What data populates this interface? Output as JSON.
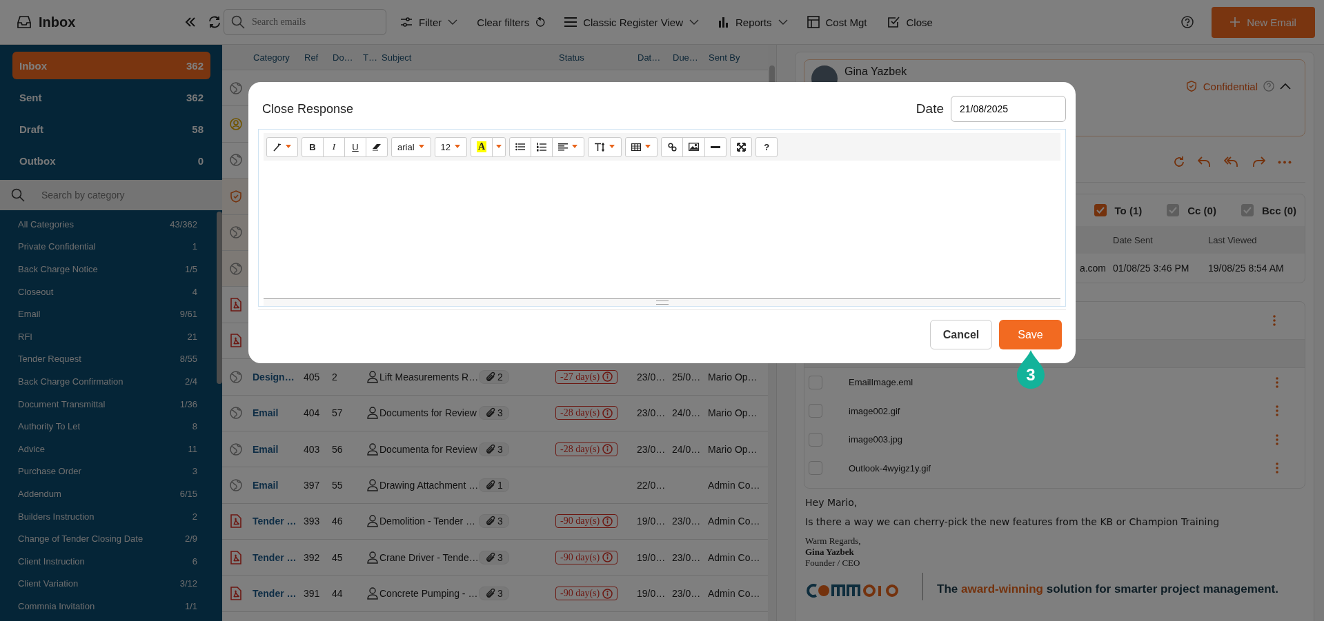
{
  "app_header": {
    "title": "Inbox"
  },
  "toolbar": {
    "search": {
      "placeholder": "Search emails"
    },
    "items": [
      {
        "kind": "filter",
        "label": "Filter",
        "caret": true
      },
      {
        "kind": "clear",
        "label": "Clear filters",
        "caret": false
      },
      {
        "kind": "view",
        "label": "Classic Register View",
        "caret": true
      },
      {
        "kind": "reports",
        "label": "Reports",
        "caret": true
      },
      {
        "kind": "cost",
        "label": "Cost Mgt",
        "caret": false
      },
      {
        "kind": "close",
        "label": "Close",
        "caret": false
      }
    ],
    "new_button": "New Email"
  },
  "folders": [
    {
      "label": "Inbox",
      "count": "362",
      "selected": true
    },
    {
      "label": "Sent",
      "count": "362",
      "selected": false
    },
    {
      "label": "Draft",
      "count": "58",
      "selected": false
    },
    {
      "label": "Outbox",
      "count": "0",
      "selected": false
    }
  ],
  "category_search": {
    "placeholder": "Search by category"
  },
  "categories": [
    {
      "label": "All Categories",
      "count": "43/362"
    },
    {
      "label": "Private Confidential",
      "count": "1"
    },
    {
      "label": "Back Charge Notice",
      "count": "1/5"
    },
    {
      "label": "Closeout",
      "count": "4"
    },
    {
      "label": "Email",
      "count": "9/61"
    },
    {
      "label": "RFI",
      "count": "21"
    },
    {
      "label": "Tender Request",
      "count": "8/55"
    },
    {
      "label": "Back Charge Confirmation",
      "count": "2/4"
    },
    {
      "label": "Document Transmittal",
      "count": "1/36"
    },
    {
      "label": "Authority To Let",
      "count": "8"
    },
    {
      "label": "Advice",
      "count": "11"
    },
    {
      "label": "Purchase Order",
      "count": "3"
    },
    {
      "label": "Addendum",
      "count": "6/15"
    },
    {
      "label": "Builders Instruction",
      "count": "2"
    },
    {
      "label": "Change of Tender Closing Date",
      "count": "2/9"
    },
    {
      "label": "Client Instruction",
      "count": "6"
    },
    {
      "label": "Client Variation",
      "count": "3/12"
    },
    {
      "label": "Commnia Invitation",
      "count": "1/1"
    }
  ],
  "table": {
    "columns": [
      "Category",
      "Ref",
      "Do…",
      "T…",
      "Subject",
      "Status",
      "Dat…",
      "Due…",
      "Sent By"
    ],
    "rows": [
      {
        "kind": "globe"
      },
      {
        "kind": "user"
      },
      {
        "kind": "globe"
      },
      {
        "kind": "shield"
      },
      {
        "kind": "globe"
      },
      {
        "kind": "globe"
      },
      {
        "kind": "pdf"
      },
      {
        "kind": "pdf"
      },
      {
        "kind": "globe",
        "category": "Design…",
        "ref": "405",
        "doc": "2",
        "subject": "Lift Measurements R…",
        "attachments": "2",
        "status": "-27 day(s)",
        "date": "23/0…",
        "due": "25/0…",
        "sent_by": "Mario Op…"
      },
      {
        "kind": "globe",
        "category": "Email",
        "ref": "404",
        "doc": "57",
        "subject": "Documents for Review",
        "attachments": "3",
        "status": "-28 day(s)",
        "date": "23/0…",
        "due": "24/0…",
        "sent_by": "Mario Op…"
      },
      {
        "kind": "globe",
        "category": "Email",
        "ref": "403",
        "doc": "56",
        "subject": "Documenta for Review",
        "attachments": "3",
        "status": "-28 day(s)",
        "date": "23/0…",
        "due": "24/0…",
        "sent_by": "Mario Op…"
      },
      {
        "kind": "globe",
        "category": "Email",
        "ref": "397",
        "doc": "55",
        "subject": "Drawing Attachment …",
        "attachments": "1",
        "date": "22/0…",
        "sent_by": "Admin Co…"
      },
      {
        "kind": "pdf",
        "category": "Tender …",
        "ref": "393",
        "doc": "46",
        "subject": "Demolition - Tender …",
        "attachments": "3",
        "status": "-90 day(s)",
        "date": "19/0…",
        "due": "23/0…",
        "sent_by": "Admin Co…"
      },
      {
        "kind": "pdf",
        "category": "Tender …",
        "ref": "392",
        "doc": "45",
        "subject": "Crane Driver - Tende…",
        "attachments": "3",
        "status": "-90 day(s)",
        "date": "19/0…",
        "due": "23/0…",
        "sent_by": "Admin Co…"
      },
      {
        "kind": "pdf",
        "category": "Tender …",
        "ref": "391",
        "doc": "44",
        "subject": "Concrete Pumping - …",
        "attachments": "3",
        "status": "-90 day(s)",
        "date": "19/0…",
        "due": "23/0…",
        "sent_by": "Admin Co…"
      }
    ]
  },
  "email": {
    "sender": "Gina Yazbek",
    "confidential": "Confidential",
    "recipient_filters": [
      {
        "label": "To (1)",
        "checked": true,
        "disabled": false
      },
      {
        "label": "Cc (0)",
        "checked": true,
        "disabled": true
      },
      {
        "label": "Bcc (0)",
        "checked": true,
        "disabled": true
      }
    ],
    "recipient_columns": [
      "Date Sent",
      "Last Viewed"
    ],
    "recipient_row": [
      "a.com",
      "01/08/25 3:46 PM",
      "19/08/25 8:54 AM"
    ],
    "attachments": [
      {
        "name": "EmailImage.eml",
        "checked": false
      },
      {
        "name": "image002.gif",
        "checked": false
      },
      {
        "name": "image003.jpg",
        "checked": false
      },
      {
        "name": "Outlook-4wyigz1y.gif",
        "checked": false
      }
    ],
    "greeting": "Hey Mario,",
    "message": "Is there a way we can cherry-pick the new features from the KB or Champion Training",
    "signature": {
      "closing": "Warm Regards,",
      "name": "Gina Yazbek",
      "role": "Founder / CEO"
    },
    "tagline": {
      "before": "The",
      "highlight": "award-winning",
      "after": "solution for smarter project management."
    }
  },
  "modal": {
    "title": "Close Response",
    "date_label": "Date",
    "date_value": "21/08/2025",
    "tool_groups": [
      [
        {
          "kind": "style",
          "caret": true
        }
      ],
      [
        {
          "kind": "label",
          "text": "B",
          "caret": false
        },
        {
          "kind": "label",
          "text": "I",
          "caret": false
        },
        {
          "kind": "label",
          "text": "U",
          "caret": false
        },
        {
          "kind": "eraser",
          "caret": false
        }
      ],
      [
        {
          "kind": "label",
          "text": "arial",
          "caret": true
        }
      ],
      [
        {
          "kind": "label",
          "text": "12",
          "caret": true
        }
      ],
      [
        {
          "kind": "highlight",
          "text": "A",
          "caret": true
        }
      ],
      [
        {
          "kind": "bullets",
          "caret": false
        },
        {
          "kind": "numbers",
          "caret": false
        },
        {
          "kind": "align",
          "caret": true
        }
      ],
      [
        {
          "kind": "lineheight",
          "caret": true
        }
      ],
      [
        {
          "kind": "table",
          "caret": true
        }
      ],
      [
        {
          "kind": "link",
          "caret": false
        },
        {
          "kind": "image",
          "caret": false
        },
        {
          "kind": "rule",
          "caret": false
        }
      ],
      [
        {
          "kind": "fullscreen",
          "caret": false
        }
      ],
      [
        {
          "kind": "label",
          "text": "?",
          "caret": false
        }
      ]
    ],
    "buttons": [
      {
        "kind": "secondary",
        "label": "Cancel"
      },
      {
        "kind": "primary",
        "label": "Save"
      }
    ],
    "step": "3"
  }
}
